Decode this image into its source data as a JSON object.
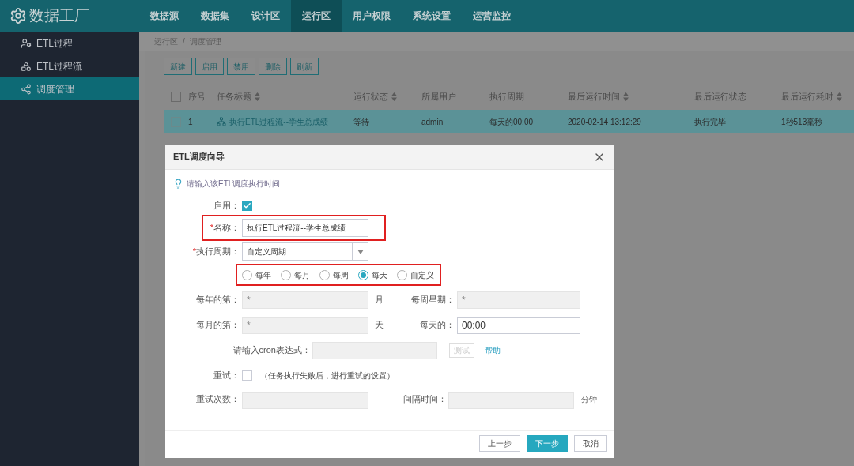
{
  "brand": "数据工厂",
  "nav": [
    {
      "label": "数据源",
      "selected": false
    },
    {
      "label": "数据集",
      "selected": false
    },
    {
      "label": "设计区",
      "selected": false
    },
    {
      "label": "运行区",
      "selected": true
    },
    {
      "label": "用户权限",
      "selected": false
    },
    {
      "label": "系统设置",
      "selected": false
    },
    {
      "label": "运营监控",
      "selected": false
    }
  ],
  "sidebar": [
    {
      "label": "ETL过程",
      "selected": false,
      "kind": "process"
    },
    {
      "label": "ETL过程流",
      "selected": false,
      "kind": "flow"
    },
    {
      "label": "调度管理",
      "selected": true,
      "kind": "schedule"
    }
  ],
  "breadcrumb": {
    "items": [
      "运行区",
      "调度管理"
    ],
    "separator": "/"
  },
  "toolbar": [
    "新建",
    "启用",
    "禁用",
    "删除",
    "刷新"
  ],
  "table": {
    "all_checked": false,
    "columns": [
      {
        "label": "序号",
        "sortable": false
      },
      {
        "label": "任务标题",
        "sortable": true
      },
      {
        "label": "运行状态",
        "sortable": true
      },
      {
        "label": "所属用户",
        "sortable": false
      },
      {
        "label": "执行周期",
        "sortable": false
      },
      {
        "label": "最后运行时间",
        "sortable": true
      },
      {
        "label": "最后运行状态",
        "sortable": false
      },
      {
        "label": "最后运行耗时",
        "sortable": true
      }
    ],
    "rows": [
      {
        "selected": true,
        "checked": false,
        "cells": [
          "1",
          "执行ETL过程流--学生总成绩",
          "等待",
          "admin",
          "每天的00:00",
          "2020-02-14 13:12:29",
          "执行完毕",
          "1秒513毫秒"
        ]
      }
    ]
  },
  "dialog": {
    "title": "ETL调度向导",
    "hint": "请输入该ETL调度执行时间",
    "enabled": {
      "label": "启用：",
      "checked": true
    },
    "name": {
      "required_mark": "*",
      "label": "名称：",
      "value": "执行ETL过程流--学生总成绩",
      "highlighted": true
    },
    "period": {
      "required_mark": "*",
      "label": "执行周期：",
      "value": "自定义周期"
    },
    "frequencies_highlighted": true,
    "frequencies": [
      {
        "label": "每年",
        "selected": false
      },
      {
        "label": "每月",
        "selected": false
      },
      {
        "label": "每周",
        "selected": false
      },
      {
        "label": "每天",
        "selected": true
      },
      {
        "label": "自定义",
        "selected": false
      }
    ],
    "year_month": {
      "label": "每年的第：",
      "placeholder": "*",
      "disabled": true,
      "unit": "月"
    },
    "week_day": {
      "label": "每周星期：",
      "placeholder": "*",
      "disabled": true
    },
    "month_day": {
      "label": "每月的第：",
      "placeholder": "*",
      "disabled": true,
      "unit": "天"
    },
    "daily_time": {
      "label": "每天的：",
      "value": "00:00",
      "disabled": false
    },
    "cron": {
      "label": "请输入cron表达式：",
      "disabled": true,
      "test_button": "测试",
      "help_link": "帮助"
    },
    "retry": {
      "label": "重试：",
      "checked": false,
      "note": "（任务执行失败后，进行重试的设置）"
    },
    "retry_count": {
      "label": "重试次数：",
      "disabled": true
    },
    "interval": {
      "label": "间隔时间：",
      "disabled": true,
      "unit": "分钟"
    },
    "buttons": [
      {
        "label": "上一步",
        "kind": "default"
      },
      {
        "label": "下一步",
        "kind": "primary"
      },
      {
        "label": "取消",
        "kind": "default"
      }
    ]
  }
}
